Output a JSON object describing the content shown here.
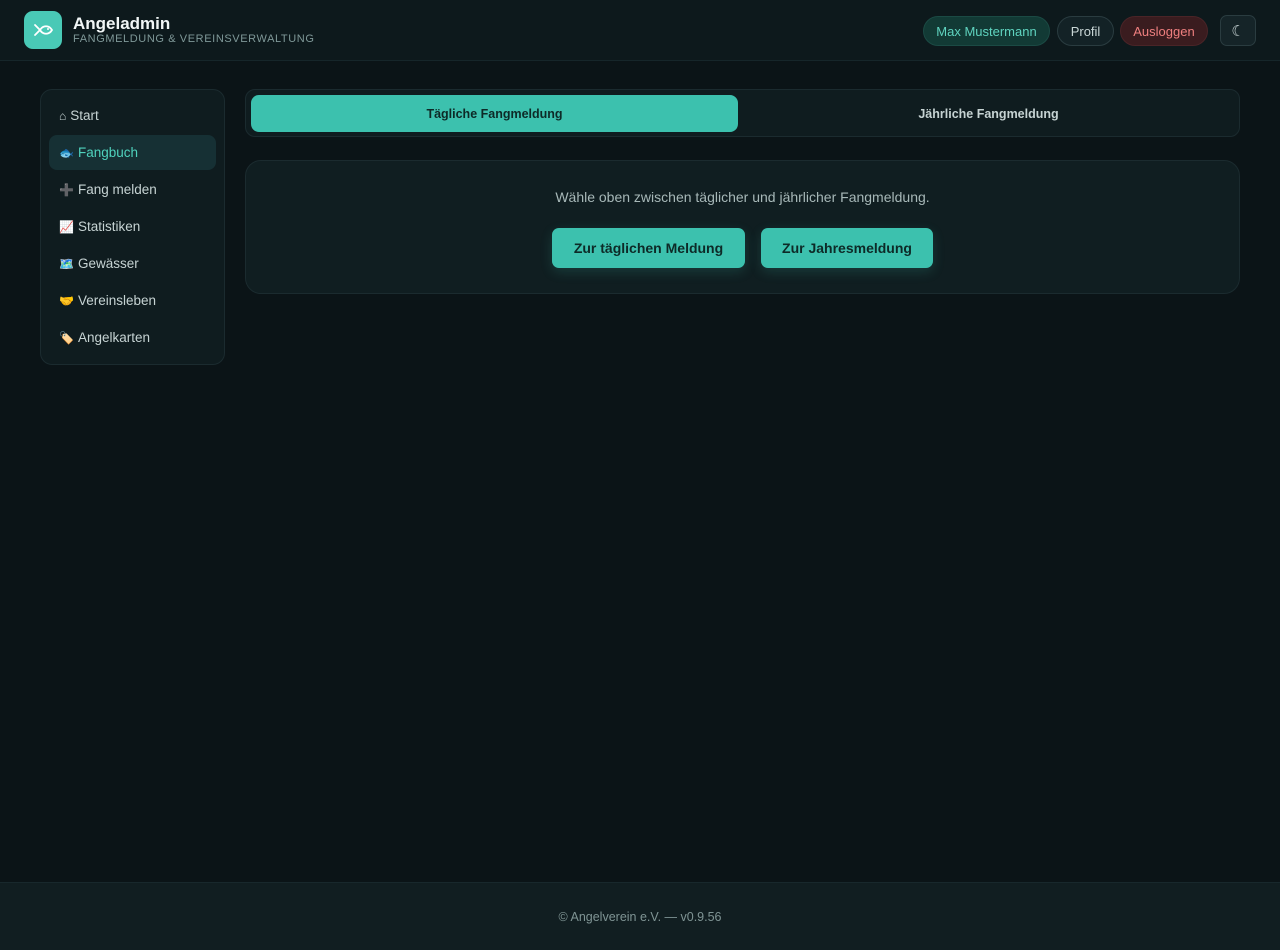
{
  "header": {
    "title": "Angeladmin",
    "subtitle": "FANGMELDUNG & VEREINSVERWALTUNG",
    "user": "Max Mustermann",
    "profile": "Profil",
    "logout": "Ausloggen",
    "theme_icon": "☾"
  },
  "sidebar": {
    "items": [
      {
        "icon": "⌂",
        "label": "Start"
      },
      {
        "icon": "🐟",
        "label": "Fangbuch"
      },
      {
        "icon": "➕",
        "label": "Fang melden"
      },
      {
        "icon": "📈",
        "label": "Statistiken"
      },
      {
        "icon": "🗺️",
        "label": "Gewässer"
      },
      {
        "icon": "🤝",
        "label": "Vereinsleben"
      },
      {
        "icon": "🏷️",
        "label": "Angelkarten"
      }
    ]
  },
  "tabs": {
    "daily": "Tägliche Fangmeldung",
    "yearly": "Jährliche Fangmeldung"
  },
  "card": {
    "message": "Wähle oben zwischen täglicher und jährlicher Fangmeldung.",
    "daily_button": "Zur täglichen Meldung",
    "yearly_button": "Zur Jahresmeldung"
  },
  "footer": {
    "text": "© Angelverein e.V. — v0.9.56"
  },
  "colors": {
    "accent": "#3cc1ae",
    "background": "#0b1417",
    "danger": "#ef7f7f"
  }
}
